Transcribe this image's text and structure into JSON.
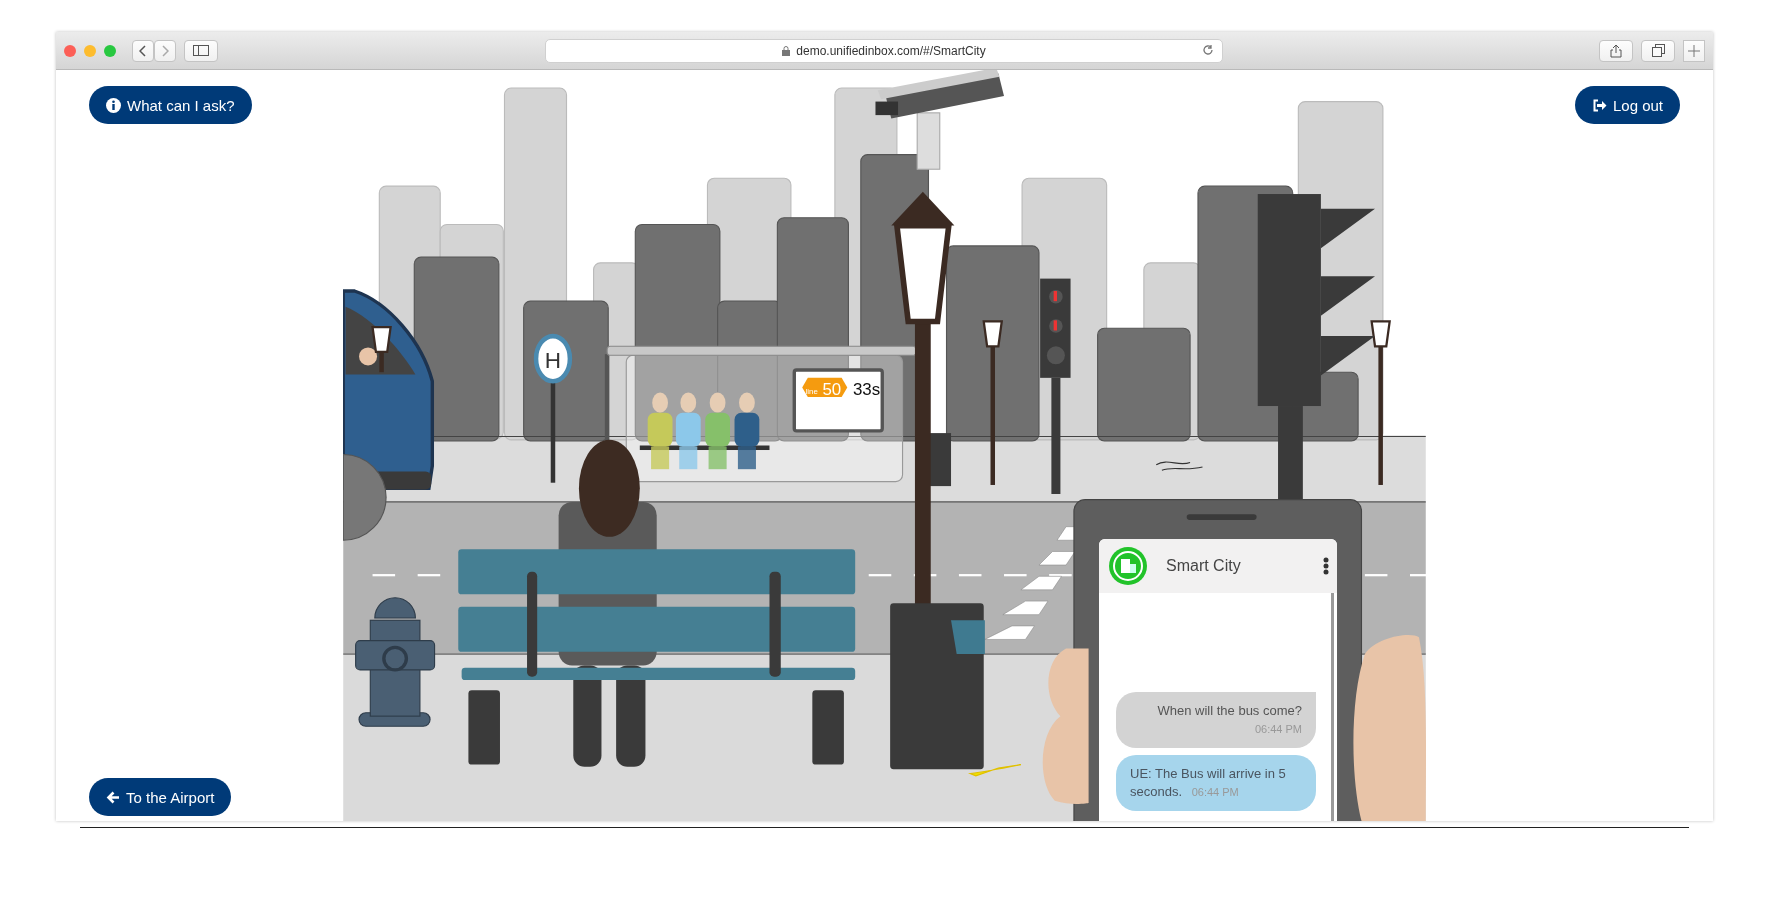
{
  "browser": {
    "url": "demo.unifiedinbox.com/#/SmartCity"
  },
  "help_button": {
    "label": "What can I ask?"
  },
  "logout_button": {
    "label": "Log out"
  },
  "airport_button": {
    "label": "To the Airport"
  },
  "stop_sign": {
    "letter": "H"
  },
  "bus_display": {
    "line_label": "line",
    "line": "50",
    "countdown": "33s"
  },
  "chat": {
    "title": "Smart City",
    "messages": [
      {
        "kind": "user",
        "text": "When will the bus come?",
        "time": "06:44 PM"
      },
      {
        "kind": "bot",
        "text": "UE: The Bus will arrive in 5 seconds.",
        "time": "06:44 PM"
      }
    ]
  }
}
